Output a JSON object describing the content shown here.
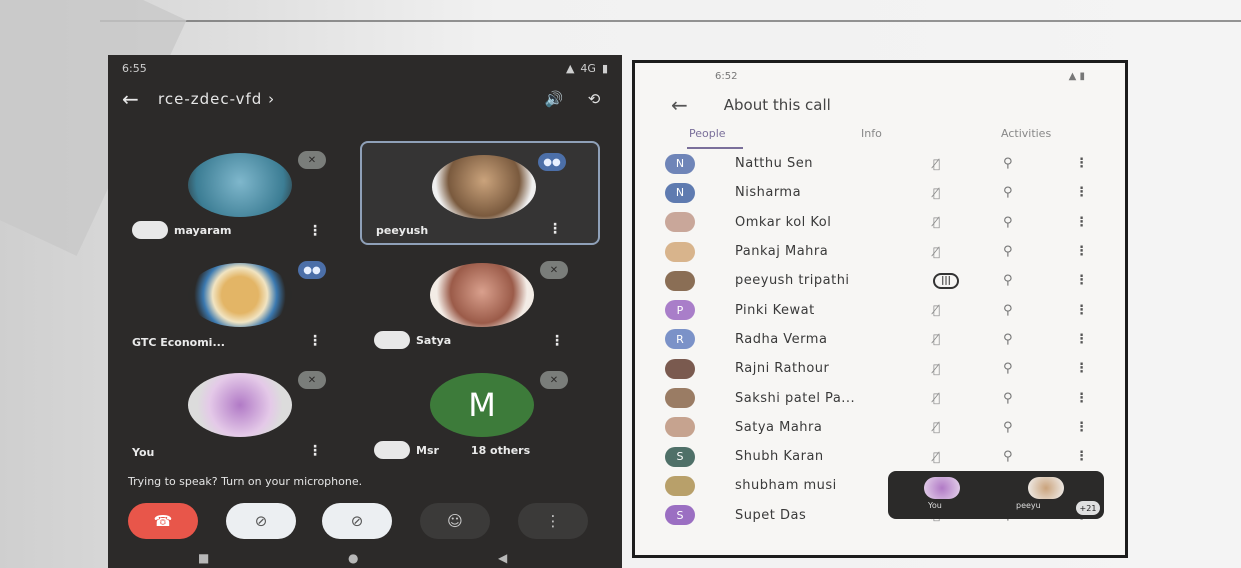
{
  "meet": {
    "status_time": "6:55",
    "status_network": "4G",
    "meeting_code": "rce-zdec-vfd",
    "meeting_chevron": "›",
    "tiles": [
      {
        "name": "mayaram",
        "mic": "muted",
        "kebab": "⋮"
      },
      {
        "name": "peeyush",
        "mic": "speaking",
        "kebab": "⋮"
      },
      {
        "name": "GTC Economi...",
        "mic": "speaking",
        "kebab": "⋮"
      },
      {
        "name": "Satya",
        "mic": "muted",
        "kebab": "⋮"
      },
      {
        "name": "You",
        "mic": "muted",
        "kebab": "⋮"
      },
      {
        "name": "Msr",
        "mic": "muted",
        "letter": "M",
        "others": "18 others"
      }
    ],
    "prompt": "Trying to speak? Turn on your microphone.",
    "controls": [
      "end-call",
      "camera-off",
      "mic-off",
      "emoji",
      "more"
    ]
  },
  "about": {
    "status_time": "6:52",
    "title": "About this call",
    "tabs": [
      "People",
      "Info",
      "Activities"
    ],
    "selected_tab": "People",
    "people": [
      {
        "name": "Natthu Sen",
        "initial": "N",
        "color": "#6f85b8",
        "mic": "muted"
      },
      {
        "name": "Nisharma",
        "initial": "N",
        "color": "#5f7bb0",
        "mic": "muted"
      },
      {
        "name": "Omkar kol Kol",
        "initial": "",
        "color": "#c9a79a",
        "mic": "muted"
      },
      {
        "name": "Pankaj Mahra",
        "initial": "",
        "color": "#d8b48c",
        "mic": "muted"
      },
      {
        "name": "peeyush tripathi",
        "initial": "",
        "color": "#8a6e55",
        "mic": "speaking"
      },
      {
        "name": "Pinki Kewat",
        "initial": "P",
        "color": "#a97ec9",
        "mic": "muted"
      },
      {
        "name": "Radha Verma",
        "initial": "R",
        "color": "#7b92c8",
        "mic": "muted"
      },
      {
        "name": "Rajni Rathour",
        "initial": "",
        "color": "#7a5a4f",
        "mic": "muted"
      },
      {
        "name": "Sakshi patel Pa...",
        "initial": "",
        "color": "#9a7c64",
        "mic": "muted"
      },
      {
        "name": "Satya Mahra",
        "initial": "",
        "color": "#c6a38f",
        "mic": "muted"
      },
      {
        "name": "Shubh Karan",
        "initial": "S",
        "color": "#4f7068",
        "mic": "muted"
      },
      {
        "name": "shubham musi",
        "initial": "",
        "color": "#b8a06a",
        "mic": "muted"
      },
      {
        "name": "Supet Das",
        "initial": "S",
        "color": "#9b6fc2",
        "mic": "muted"
      }
    ],
    "pip": {
      "you_label": "You",
      "other_label": "peeyu",
      "count": "+21"
    }
  }
}
